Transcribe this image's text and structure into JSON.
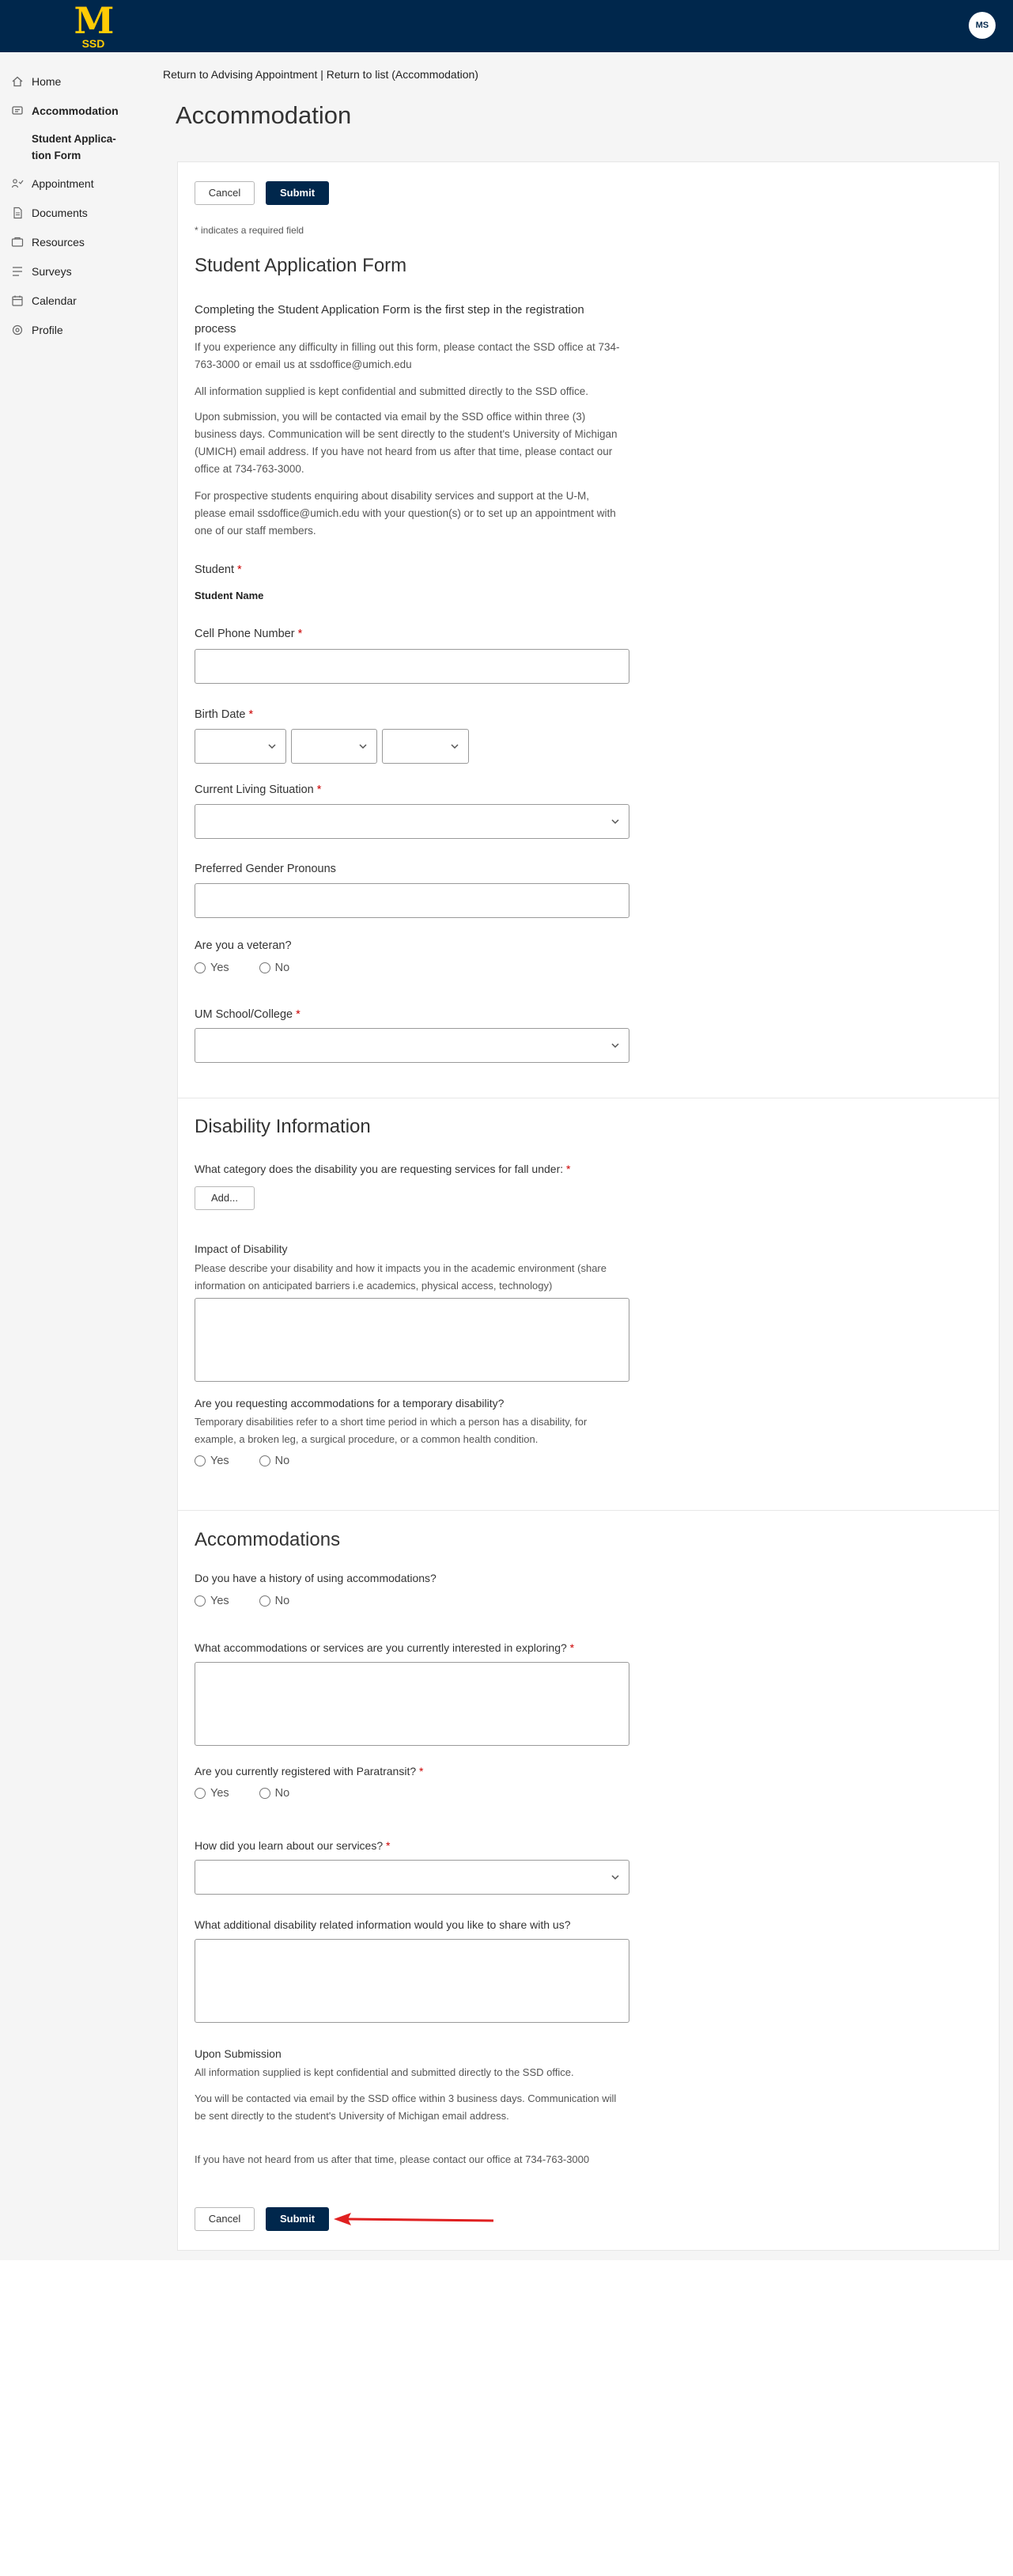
{
  "header": {
    "logo_letter": "M",
    "logo_text": "SSD",
    "avatar_initials": "MS"
  },
  "sidebar": {
    "items": [
      {
        "label": "Home",
        "icon": "home-icon"
      },
      {
        "label": "Accommodation",
        "icon": "accommodation-icon"
      },
      {
        "label": "Appointment",
        "icon": "appointment-icon"
      },
      {
        "label": "Documents",
        "icon": "documents-icon"
      },
      {
        "label": "Resources",
        "icon": "resources-icon"
      },
      {
        "label": "Surveys",
        "icon": "surveys-icon"
      },
      {
        "label": "Calendar",
        "icon": "calendar-icon"
      },
      {
        "label": "Profile",
        "icon": "profile-icon"
      }
    ],
    "sub_item": "Student Applica-tion Form"
  },
  "breadcrumb": {
    "link1": "Return to Advising Appointment",
    "separator": " | ",
    "link2": "Return to list (Accommodation)"
  },
  "page_title": "Accommodation",
  "buttons": {
    "cancel": "Cancel",
    "submit": "Submit"
  },
  "required_note": "* indicates a required field",
  "form": {
    "title": "Student Application Form",
    "intro_heading": "Completing the Student Application Form is the first step in the registration process",
    "intro_p1": "If you experience any difficulty in filling out this form, please contact the SSD office at 734-763-3000 or email us at ssdoffice@umich.edu",
    "intro_p2": "All information supplied is kept confidential and submitted directly to the SSD office.",
    "intro_p3": "Upon submission, you will be contacted via email by the SSD office within three (3) business days. Communication will be sent directly to the student's University of Michigan (UMICH) email address. If you have not heard from us after that time, please contact our office at 734-763-3000.",
    "intro_p4": "For prospective students enquiring about disability services and support at the U-M, please email ssdoffice@umich.edu with your question(s) or to set up an appointment with one of our staff members.",
    "student_label": "Student",
    "student_name": "Student Name",
    "cell_phone_label": "Cell Phone Number",
    "birth_date_label": "Birth Date",
    "living_label": "Current Living Situation",
    "pronouns_label": "Preferred Gender Pronouns",
    "veteran_label": "Are you a veteran?",
    "yes": "Yes",
    "no": "No",
    "school_label": "UM School/College",
    "required_mark": "*"
  },
  "disability": {
    "title": "Disability Information",
    "category_label": "What category does the disability you are requesting services for fall under:",
    "add_button": "Add...",
    "impact_label": "Impact of Disability",
    "impact_help": "Please describe your disability and how it impacts you in the academic environment (share information on anticipated barriers i.e academics, physical access, technology)",
    "temporary_label": "Are you requesting accommodations for a temporary disability?",
    "temporary_help": "Temporary disabilities refer to a short time period in which a person has a disability, for example, a broken leg, a surgical procedure, or a common health condition."
  },
  "accommodations": {
    "title": "Accommodations",
    "history_label": "Do you have a history of using accommodations?",
    "interest_label": "What accommodations or services are you currently interested in exploring?",
    "paratransit_label": "Are you currently registered with Paratransit?",
    "learn_label": "How did you learn about our services?",
    "additional_label": "What additional disability related information would you like to share with us?",
    "upon_title": "Upon Submission",
    "upon_p1": "All information supplied is kept confidential and submitted directly to the SSD office.",
    "upon_p2": "You will be contacted via email by the SSD office within 3 business days. Communication will be sent directly to the student's University of Michigan email address.",
    "upon_p3": "If you have not heard from us after that time, please contact our office at 734-763-3000"
  },
  "colors": {
    "brand_navy": "#00274c",
    "brand_maize": "#ffcb05",
    "required_red": "#cc0000",
    "annotation_arrow": "#e02020"
  }
}
